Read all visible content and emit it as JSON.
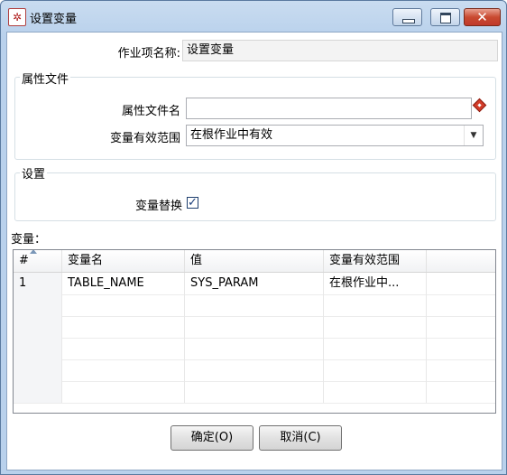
{
  "window": {
    "title": "设置变量"
  },
  "form": {
    "job_name_label": "作业项名称:",
    "job_name_value": "设置变量",
    "props_group_title": "属性文件",
    "props_file_label": "属性文件名",
    "props_file_value": "",
    "scope_label": "变量有效范围",
    "scope_value": "在根作业中有效",
    "settings_group_title": "设置",
    "replace_label": "变量替换",
    "replace_checked": true
  },
  "variables": {
    "label": "变量：",
    "columns": [
      "#",
      "变量名",
      "值",
      "变量有效范围"
    ],
    "rows": [
      {
        "num": "1",
        "name": "TABLE_NAME",
        "value": "SYS_PARAM",
        "scope": "在根作业中..."
      }
    ]
  },
  "buttons": {
    "ok": "确定(O)",
    "cancel": "取消(C)"
  }
}
